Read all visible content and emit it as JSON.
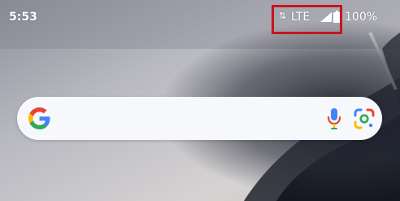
{
  "status_bar": {
    "time": "5:53",
    "network_arrows": "⇅",
    "network_type": "LTE",
    "signal_icon": "cell-signal-icon",
    "battery_icon": "battery-icon",
    "battery_percent": "100%"
  },
  "search_widget": {
    "logo_icon": "google-g-icon",
    "voice_icon": "microphone-icon",
    "lens_icon": "google-lens-icon"
  },
  "colors": {
    "highlight": "#c8141e",
    "search_bar_bg": "#f7f8fb",
    "google_blue": "#4285F4",
    "google_red": "#EA4335",
    "google_yellow": "#FBBC05",
    "google_green": "#34A853"
  }
}
